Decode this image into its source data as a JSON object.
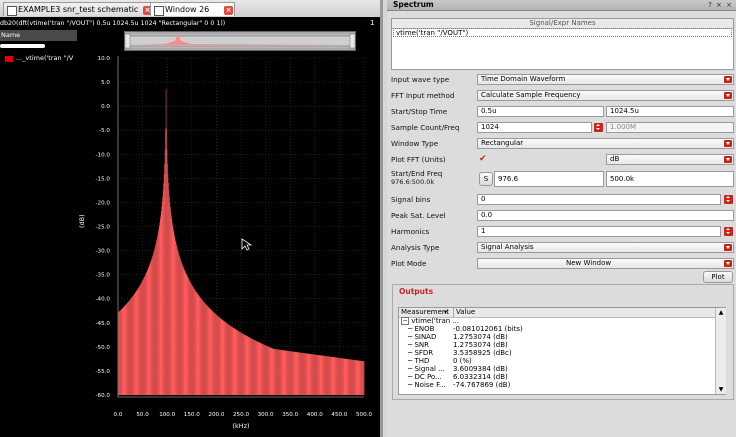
{
  "plot_window": {
    "tabs": [
      {
        "label": "EXAMPLE3 snr_test schematic",
        "active": false
      },
      {
        "label": "Window 26",
        "active": true
      }
    ],
    "expression": "db20(dft(vtime('tran \"/VOUT\") 0.5u 1024.5u 1024 \"Rectangular\" 0 0 1))",
    "corner_label": "1",
    "legend_header": "Name",
    "legend_entry": "..._vtime('tran \"/V",
    "colors": {
      "trace": "#ff5c5c",
      "legend_swatch": "#e20000",
      "background": "#000000"
    }
  },
  "chart_data": {
    "type": "bar",
    "title": "",
    "xlabel": "(kHz)",
    "ylabel": "(dB)",
    "xlim": [
      0,
      500
    ],
    "ylim": [
      -60,
      10
    ],
    "x_ticks": [
      "0.0",
      "50.0",
      "100.0",
      "150.0",
      "200.0",
      "250.0",
      "300.0",
      "350.0",
      "400.0",
      "450.0",
      "500.0"
    ],
    "y_ticks": [
      "10.0",
      "5.0",
      "0.0",
      "-5.0",
      "-10.0",
      "-15.0",
      "-20.0",
      "-25.0",
      "-30.0",
      "-35.0",
      "-40.0",
      "-45.0",
      "-50.0",
      "-55.0",
      "-60.0"
    ],
    "series": [
      {
        "name": "..._vtime('tran \"/V",
        "peak_x": 97.66,
        "peak_y": 3.5,
        "noise_floor_start": -46,
        "noise_floor_end": -53
      }
    ]
  },
  "spectrum": {
    "title": "Spectrum",
    "title_controls": "? × ×",
    "signal_header": "Signal/Expr Names",
    "signal_value": "vtime('tran \"/VOUT\")",
    "rows": {
      "input_wave_type": {
        "label": "Input wave type",
        "value": "Time Domain Waveform"
      },
      "fft_input_method": {
        "label": "FFT Input method",
        "value": "Calculate Sample Frequency"
      },
      "start_stop_time": {
        "label": "Start/Stop Time",
        "start": "0.5u",
        "stop": "1024.5u"
      },
      "sample_count": {
        "label": "Sample Count/Freq",
        "count": "1024",
        "freq": "1.000M"
      },
      "window_type": {
        "label": "Window Type",
        "value": "Rectangular"
      },
      "plot_fft": {
        "label": "Plot FFT (Units)",
        "units": "dB"
      },
      "start_end_freq": {
        "label": "Start/End Freq",
        "sublabel": "976.6:500.0k",
        "s_button": "S",
        "start": "976.6",
        "end": "500.0k"
      },
      "signal_bins": {
        "label": "Signal bins",
        "value": "0"
      },
      "peak_sat_level": {
        "label": "Peak Sat. Level",
        "value": "0.0"
      },
      "harmonics": {
        "label": "Harmonics",
        "value": "1"
      },
      "analysis_type": {
        "label": "Analysis Type",
        "value": "Signal Analysis"
      },
      "plot_mode": {
        "label": "Plot Mode",
        "value": "New Window"
      }
    },
    "plot_button": "Plot",
    "outputs": {
      "title": "Outputs",
      "col_measurement": "Measurement",
      "col_value": "Value",
      "root": "vtime('tran ...",
      "items": [
        {
          "name": "ENOB",
          "value": "-0.081012061 (bits)"
        },
        {
          "name": "SINAD",
          "value": "1.2753074 (dB)"
        },
        {
          "name": "SNR",
          "value": "1.2753074 (dB)"
        },
        {
          "name": "SFDR",
          "value": "3.5358925 (dBc)"
        },
        {
          "name": "THD",
          "value": "0 (%)"
        },
        {
          "name": "Signal ...",
          "value": "3.6009384 (dB)"
        },
        {
          "name": "DC Po...",
          "value": "6.0332314 (dB)"
        },
        {
          "name": "Noise F...",
          "value": "-74.767869 (dB)"
        }
      ]
    }
  }
}
